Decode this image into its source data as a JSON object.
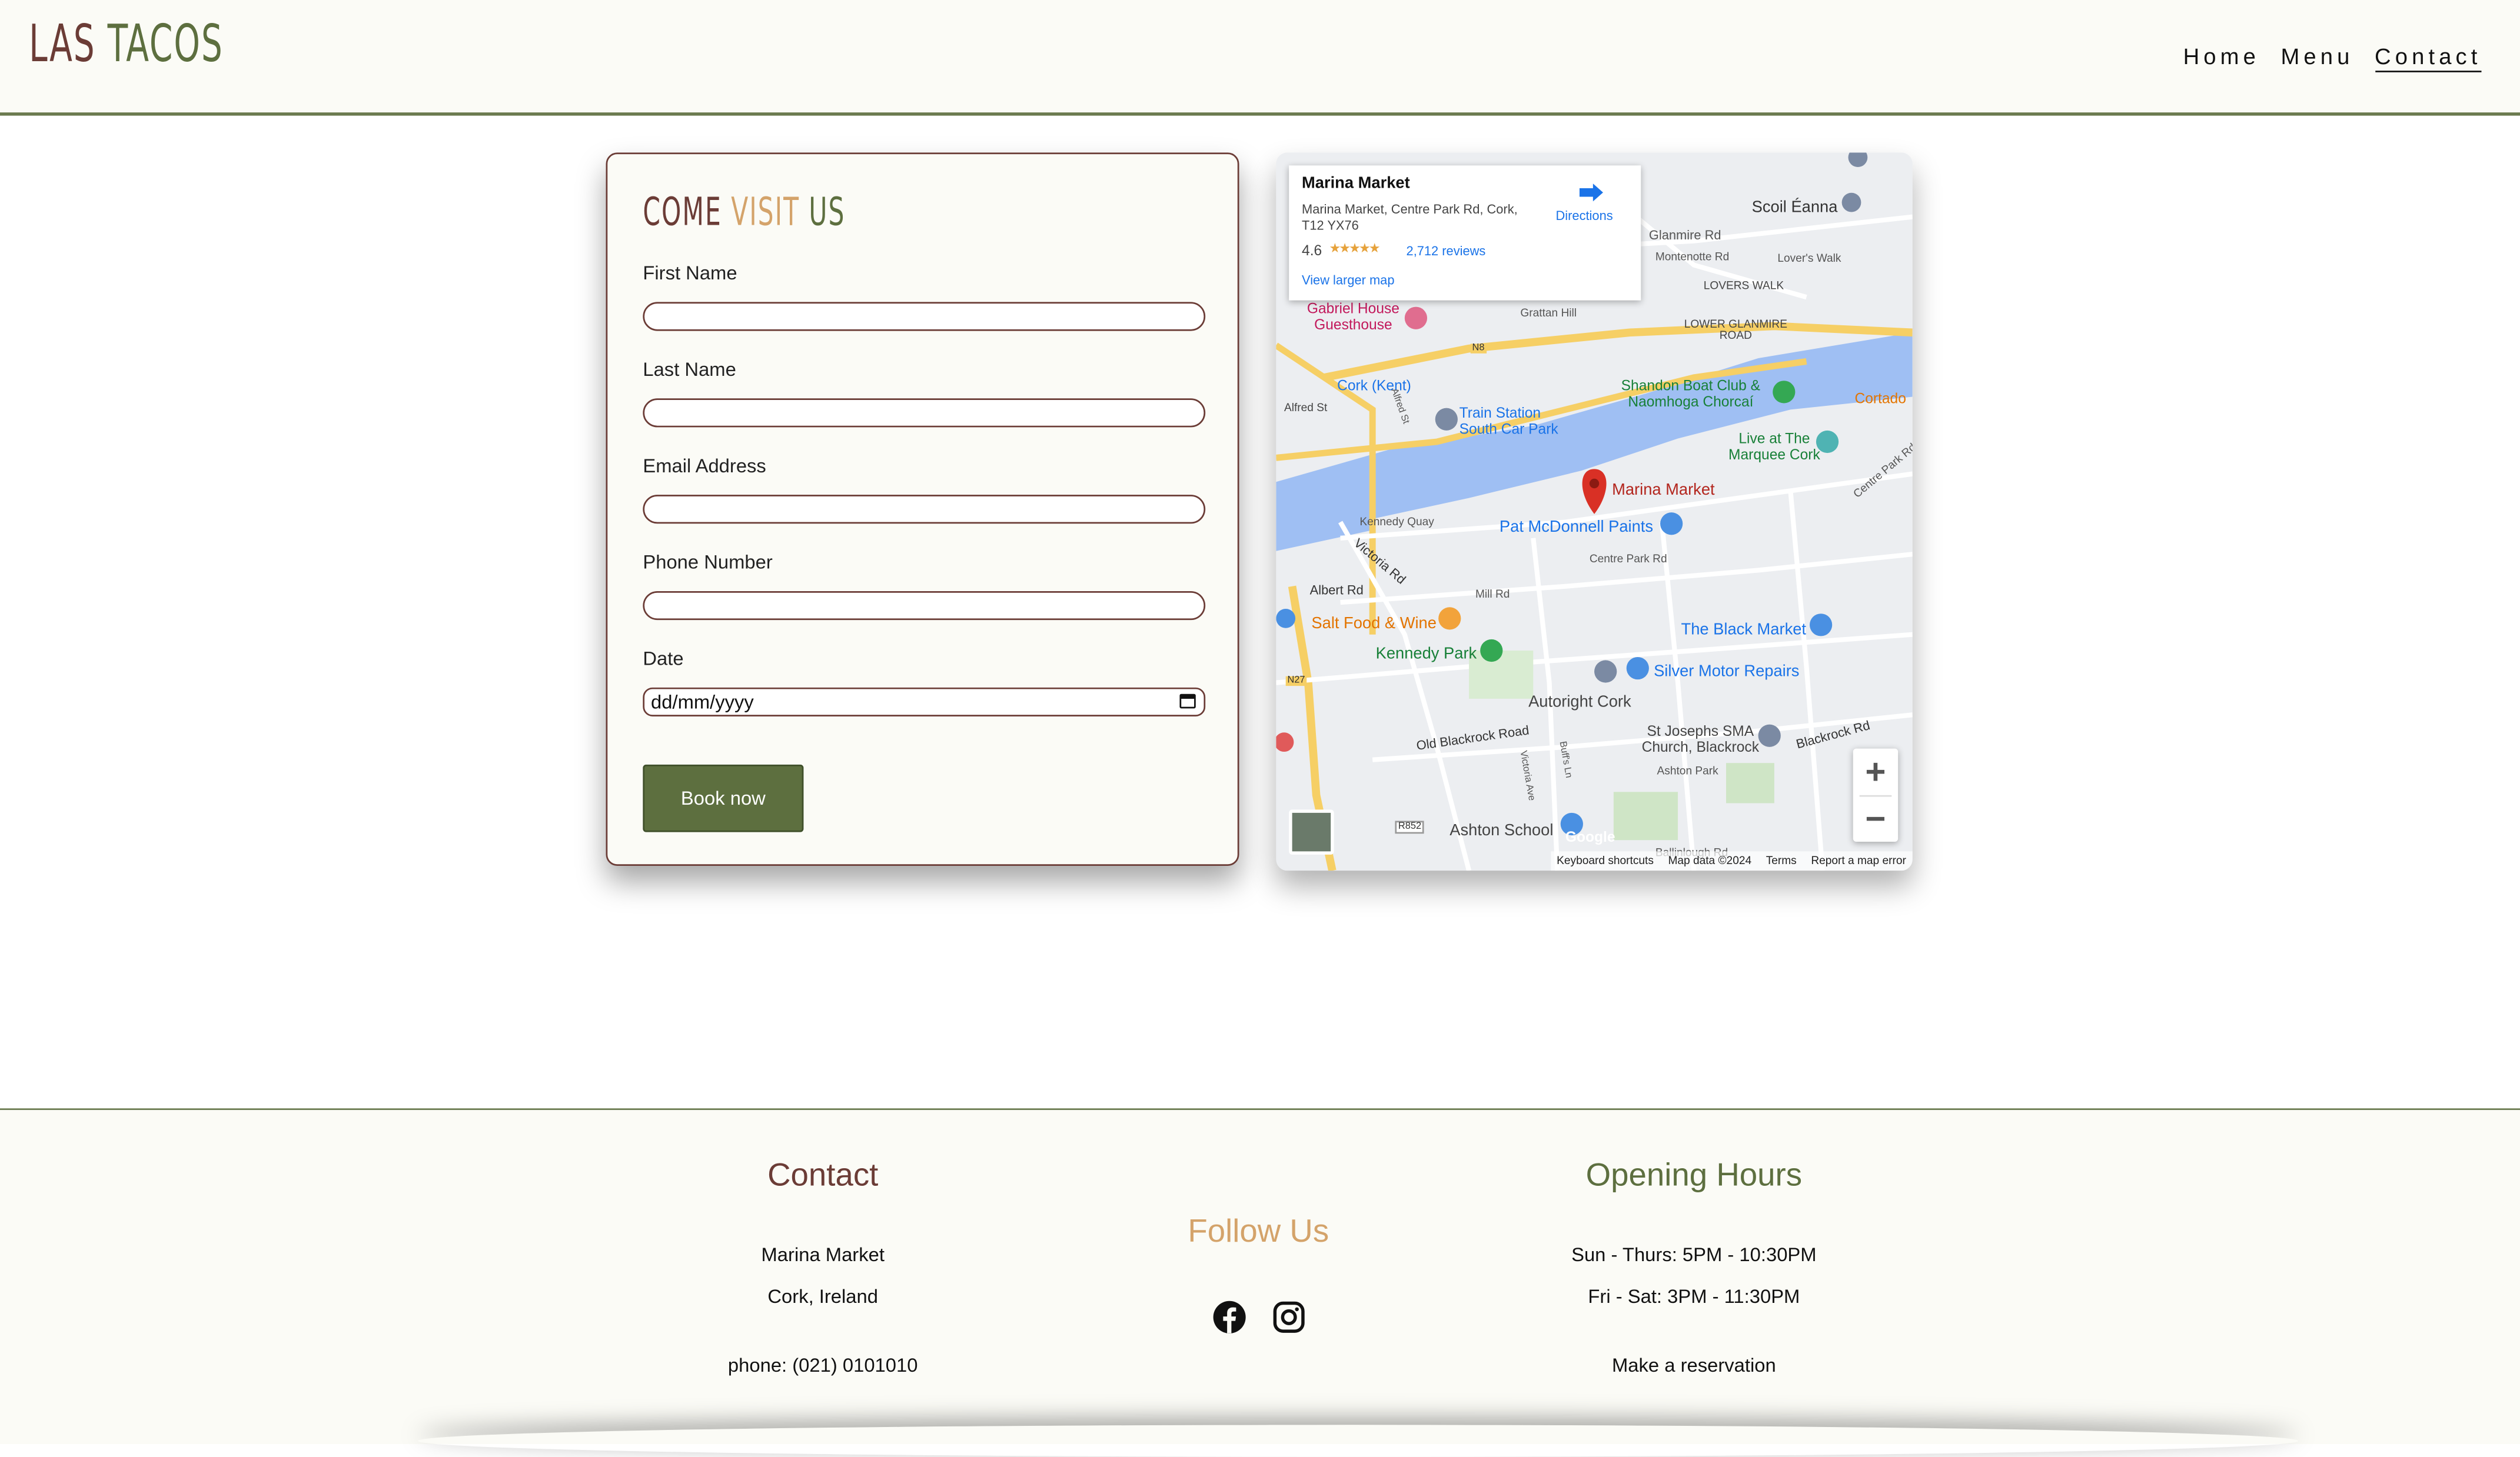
{
  "brand": {
    "logo_a": "LAS ",
    "logo_b": "TACOS",
    "color_primary": "#6b3c36",
    "color_green": "#5d6f3f",
    "color_tan": "#d4a36a"
  },
  "nav": {
    "items": [
      "Home",
      "Menu",
      "Contact"
    ],
    "active": "Contact"
  },
  "form": {
    "title_1": "COME ",
    "title_2": "VISIT",
    "title_3": " US",
    "first_name_label": "First Name",
    "last_name_label": "Last Name",
    "email_label": "Email Address",
    "phone_label": "Phone Number",
    "date_label": "Date",
    "date_placeholder": "dd/mm/yyyy",
    "submit_label": "Book now"
  },
  "map": {
    "place_name": "Marina Market",
    "address": "Marina Market, Centre Park Rd, Cork, T12 YX76",
    "rating": "4.6",
    "stars": "★★★★★",
    "reviews": "2,712 reviews",
    "view_larger": "View larger map",
    "directions": "Directions",
    "attribution": [
      "Keyboard shortcuts",
      "Map data ©2024",
      "Terms",
      "Report a map error"
    ],
    "google": "Google",
    "labels": {
      "scoil": "Scoil Éanna",
      "glanmire": "Glanmire Rd",
      "montenotte": "Montenotte Rd",
      "lovers": "Lover's Walk",
      "lovers_walk": "LOVERS WALK",
      "lower_glanmire": "LOWER GLANMIRE ROAD",
      "gabriel": "Gabriel House Guesthouse",
      "grattan": "Grattan Hill",
      "n8": "N8",
      "cork_kent": "Cork (Kent)",
      "alfred_st": "Alfred St",
      "alfred_st2": "Alfred St",
      "train": "Train Station South Car Park",
      "shandon": "Shandon Boat Club & Naomhoga Chorcaí",
      "cortado": "Cortado",
      "marquee": "Live at The Marquee Cork",
      "marina": "Marina Market",
      "kennedy_quay": "Kennedy Quay",
      "victoria_rd": "Victoria Rd",
      "pat": "Pat McDonnell Paints",
      "centre_park": "Centre Park Rd",
      "centre_park2": "Centre Park Rd",
      "albert": "Albert Rd",
      "mill": "Mill Rd",
      "salt": "Salt Food & Wine",
      "kennedy_park": "Kennedy Park",
      "black_market": "The Black Market",
      "silver": "Silver Motor Repairs",
      "autoright": "Autoright Cork",
      "old_blackrock": "Old Blackrock Road",
      "st_josephs": "St Josephs SMA Church, Blackrock",
      "blackrock_rd": "Blackrock Rd",
      "ashton_park": "Ashton Park",
      "ashton_school": "Ashton School",
      "n27": "N27",
      "r852": "R852",
      "victoria_ave": "Victoria Ave",
      "buffs": "Buff's Ln",
      "ballinlough": "Ballinlough Rd"
    }
  },
  "footer": {
    "contact_title": "Contact",
    "contact_line1": "Marina Market",
    "contact_line2": "Cork, Ireland",
    "contact_phone": "phone: (021) 0101010",
    "follow_title": "Follow Us",
    "social_icons": [
      "facebook-icon",
      "instagram-icon"
    ],
    "hours_title": "Opening Hours",
    "hours_line1": "Sun - Thurs: 5PM - 10:30PM",
    "hours_line2": "Fri - Sat: 3PM - 11:30PM",
    "reservation": "Make a reservation"
  }
}
